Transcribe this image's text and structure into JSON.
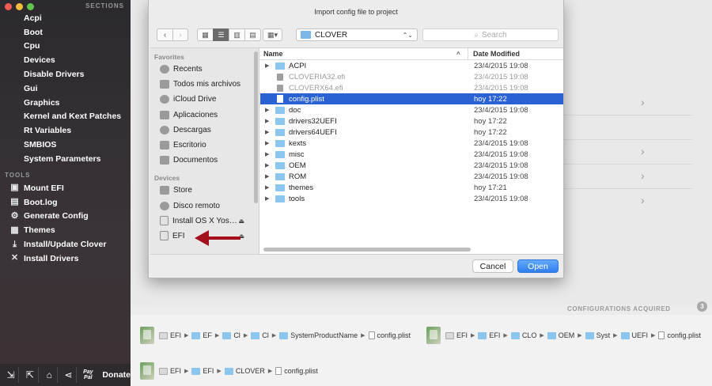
{
  "sidebar": {
    "sections_heading": "SECTIONS",
    "sections": [
      {
        "label": "Acpi",
        "name": "sidebar-item-acpi"
      },
      {
        "label": "Boot",
        "name": "sidebar-item-boot"
      },
      {
        "label": "Cpu",
        "name": "sidebar-item-cpu"
      },
      {
        "label": "Devices",
        "name": "sidebar-item-devices"
      },
      {
        "label": "Disable Drivers",
        "name": "sidebar-item-disable-drivers"
      },
      {
        "label": "Gui",
        "name": "sidebar-item-gui"
      },
      {
        "label": "Graphics",
        "name": "sidebar-item-graphics"
      },
      {
        "label": "Kernel and Kext Patches",
        "name": "sidebar-item-kernel-kext-patches"
      },
      {
        "label": "Rt Variables",
        "name": "sidebar-item-rt-variables"
      },
      {
        "label": "SMBIOS",
        "name": "sidebar-item-smbios"
      },
      {
        "label": "System Parameters",
        "name": "sidebar-item-system-parameters"
      }
    ],
    "tools_heading": "TOOLS",
    "tools": [
      {
        "label": "Mount EFI",
        "icon": "mount-icon",
        "glyph": "▣"
      },
      {
        "label": "Boot.log",
        "icon": "log-icon",
        "glyph": "▤"
      },
      {
        "label": "Generate Config",
        "icon": "generate-icon",
        "glyph": "⚙"
      },
      {
        "label": "Themes",
        "icon": "themes-icon",
        "glyph": "▦"
      },
      {
        "label": "Install/Update Clover",
        "icon": "download-icon",
        "glyph": "⤓"
      },
      {
        "label": "Install Drivers",
        "icon": "tools-icon",
        "glyph": "✕"
      }
    ],
    "bottom": {
      "paypal": "Pay Pal",
      "donate": "Donate"
    }
  },
  "dialog": {
    "title": "Import config file to project",
    "location": "CLOVER",
    "search_placeholder": "Search",
    "favorites_heading": "Favorites",
    "favorites": [
      "Recents",
      "Todos mis archivos",
      "iCloud Drive",
      "Aplicaciones",
      "Descargas",
      "Escritorio",
      "Documentos"
    ],
    "devices_heading": "Devices",
    "devices": [
      "Store",
      "Disco remoto",
      "Install OS X Yos…",
      "EFI"
    ],
    "col_name": "Name",
    "col_date": "Date Modified",
    "files": [
      {
        "name": "ACPI",
        "date": "23/4/2015 19:08",
        "kind": "folder"
      },
      {
        "name": "CLOVERIA32.efi",
        "date": "23/4/2015 19:08",
        "kind": "efi"
      },
      {
        "name": "CLOVERX64.efi",
        "date": "23/4/2015 19:08",
        "kind": "efi"
      },
      {
        "name": "config.plist",
        "date": "hoy 17:22",
        "kind": "doc",
        "selected": true
      },
      {
        "name": "doc",
        "date": "23/4/2015 19:08",
        "kind": "folder"
      },
      {
        "name": "drivers32UEFI",
        "date": "hoy 17:22",
        "kind": "folder"
      },
      {
        "name": "drivers64UEFI",
        "date": "hoy 17:22",
        "kind": "folder"
      },
      {
        "name": "kexts",
        "date": "23/4/2015 19:08",
        "kind": "folder"
      },
      {
        "name": "misc",
        "date": "23/4/2015 19:08",
        "kind": "folder"
      },
      {
        "name": "OEM",
        "date": "23/4/2015 19:08",
        "kind": "folder"
      },
      {
        "name": "ROM",
        "date": "23/4/2015 19:08",
        "kind": "folder"
      },
      {
        "name": "themes",
        "date": "hoy 17:21",
        "kind": "folder"
      },
      {
        "name": "tools",
        "date": "23/4/2015 19:08",
        "kind": "folder"
      }
    ],
    "cancel_label": "Cancel",
    "open_label": "Open"
  },
  "main": {
    "configurations_acquired": "CONFIGURATIONS ACQUIRED",
    "acquired_count": "3",
    "paths": [
      [
        "EFI",
        "EF",
        "Cl",
        "Cl",
        "SystemProductName",
        "config.plist"
      ],
      [
        "EFI",
        "EFI",
        "CLO",
        "OEM",
        "Syst",
        "UEFI",
        "config.plist"
      ],
      [
        "EFI",
        "EFI",
        "CLOVER",
        "config.plist"
      ]
    ]
  },
  "colors": {
    "selection": "#2a62d4",
    "open_button": "#2f7ef0",
    "annotation_arrow": "#a3101c",
    "folder": "#8cc6ee"
  }
}
